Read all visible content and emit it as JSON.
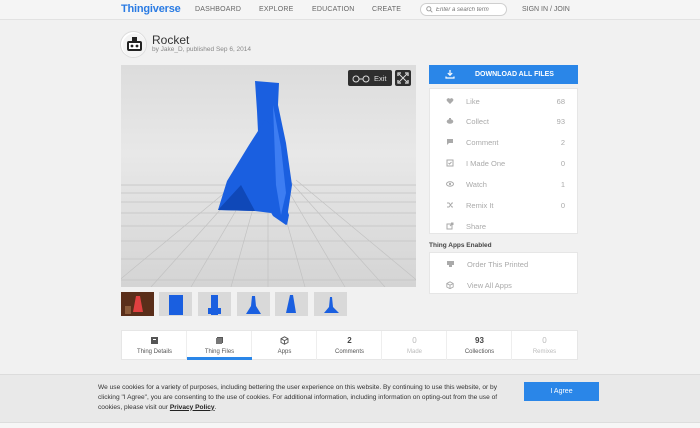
{
  "nav": {
    "logo": "Thingiverse",
    "links": [
      "DASHBOARD",
      "EXPLORE",
      "EDUCATION",
      "CREATE"
    ],
    "search_placeholder": "Enter a search term",
    "signin": "SIGN IN / JOIN"
  },
  "thing": {
    "title": "Rocket",
    "byline": "by Jake_D, published Sep 6, 2014",
    "model_color": "#1a5fe0"
  },
  "viewer": {
    "exit_label": "Exit"
  },
  "sidebar": {
    "download_label": "DOWNLOAD ALL FILES",
    "actions": [
      {
        "label": "Like",
        "count": "68",
        "icon": "heart-icon"
      },
      {
        "label": "Collect",
        "count": "93",
        "icon": "collect-icon"
      },
      {
        "label": "Comment",
        "count": "2",
        "icon": "comment-icon"
      },
      {
        "label": "I Made One",
        "count": "0",
        "icon": "made-one-icon"
      },
      {
        "label": "Watch",
        "count": "1",
        "icon": "eye-icon"
      },
      {
        "label": "Remix It",
        "count": "0",
        "icon": "remix-icon"
      },
      {
        "label": "Share",
        "count": "",
        "icon": "share-icon"
      }
    ],
    "apps_title": "Thing Apps Enabled",
    "apps": [
      {
        "label": "Order This Printed",
        "icon": "printer-icon"
      },
      {
        "label": "View All Apps",
        "icon": "cube-icon"
      }
    ]
  },
  "tabs": [
    {
      "label": "Thing Details",
      "value": "",
      "icon": "details-icon"
    },
    {
      "label": "Thing Files",
      "value": "",
      "icon": "files-icon"
    },
    {
      "label": "Apps",
      "value": "",
      "icon": "apps-icon"
    },
    {
      "label": "Comments",
      "value": "2"
    },
    {
      "label": "Made",
      "value": "0"
    },
    {
      "label": "Collections",
      "value": "93"
    },
    {
      "label": "Remixes",
      "value": "0"
    }
  ],
  "cookie": {
    "text": "We use cookies for a variety of purposes, including bettering the user experience on this website. By continuing to use this website, or by clicking \"I Agree\", you are consenting to the use of cookies. For additional information, including information on opting-out from the use of cookies, please visit our",
    "link": "Privacy Policy",
    "agree": "I Agree"
  },
  "colors": {
    "accent": "#2a86e8",
    "logo": "#2a7be3"
  }
}
